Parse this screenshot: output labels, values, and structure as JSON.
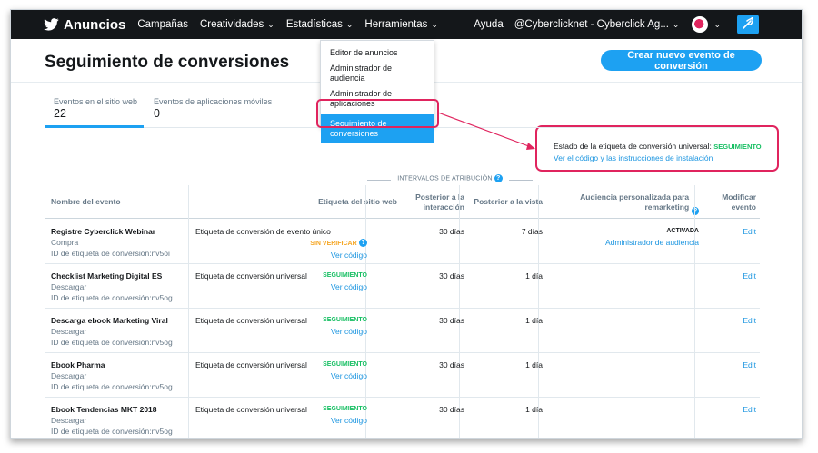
{
  "nav": {
    "brand": "Anuncios",
    "items": [
      "Campañas",
      "Creatividades",
      "Estadísticas",
      "Herramientas"
    ],
    "help": "Ayuda",
    "account": "@Cyberclicknet - Cyberclick Ag..."
  },
  "dropdown": {
    "items": [
      "Editor de anuncios",
      "Administrador de audiencia",
      "Administrador de aplicaciones",
      "Seguimiento de conversiones"
    ],
    "active_index": 3
  },
  "header": {
    "title": "Seguimiento de conversiones",
    "create_button": "Crear nuevo evento de conversión"
  },
  "tabs": [
    {
      "label": "Eventos en el sitio web",
      "count": "22"
    },
    {
      "label": "Eventos de aplicaciones móviles",
      "count": "0"
    }
  ],
  "callout": {
    "text": "Estado de la etiqueta de conversión universal:",
    "status": "SEGUIMIENTO",
    "link": "Ver el código y las instrucciones de instalación"
  },
  "table": {
    "group_header": "INTERVALOS DE ATRIBUCIÓN",
    "columns": {
      "name": "Nombre del evento",
      "tag": "Etiqueta del sitio web",
      "post_interaction": "Posterior a la interacción",
      "post_view": "Posterior a la vista",
      "audience": "Audiencia personalizada para remarketing",
      "modify": "Modificar evento"
    },
    "rows": [
      {
        "name": "Registre Cyberclick Webinar",
        "category": "Compra",
        "tag_id": "ID de etiqueta de conversión:nv5oi",
        "tag_type": "Etiqueta de conversión de evento único",
        "status": "SIN VERIFICAR",
        "view_code": "Ver código",
        "post_interaction": "30 días",
        "post_view": "7 días",
        "audience_status": "ACTIVADA",
        "audience_link": "Administrador de audiencia",
        "edit": "Edit"
      },
      {
        "name": "Checklist Marketing Digital ES",
        "category": "Descargar",
        "tag_id": "ID de etiqueta de conversión:nv5og",
        "tag_type": "Etiqueta de conversión universal",
        "status": "SEGUIMIENTO",
        "view_code": "Ver código",
        "post_interaction": "30 días",
        "post_view": "1 día",
        "audience_status": "",
        "audience_link": "",
        "edit": "Edit"
      },
      {
        "name": "Descarga ebook Marketing Viral",
        "category": "Descargar",
        "tag_id": "ID de etiqueta de conversión:nv5og",
        "tag_type": "Etiqueta de conversión universal",
        "status": "SEGUIMIENTO",
        "view_code": "Ver código",
        "post_interaction": "30 días",
        "post_view": "1 día",
        "audience_status": "",
        "audience_link": "",
        "edit": "Edit"
      },
      {
        "name": "Ebook Pharma",
        "category": "Descargar",
        "tag_id": "ID de etiqueta de conversión:nv5og",
        "tag_type": "Etiqueta de conversión universal",
        "status": "SEGUIMIENTO",
        "view_code": "Ver código",
        "post_interaction": "30 días",
        "post_view": "1 día",
        "audience_status": "",
        "audience_link": "",
        "edit": "Edit"
      },
      {
        "name": "Ebook Tendencias MKT 2018",
        "category": "Descargar",
        "tag_id": "ID de etiqueta de conversión:nv5og",
        "tag_type": "Etiqueta de conversión universal",
        "status": "SEGUIMIENTO",
        "view_code": "Ver código",
        "post_interaction": "30 días",
        "post_view": "1 día",
        "audience_status": "",
        "audience_link": "",
        "edit": "Edit"
      }
    ]
  },
  "colors": {
    "brand_blue": "#1da1f2",
    "nav_bg": "#14171a",
    "highlight_red": "#e0245e",
    "status_green": "#17bf63",
    "status_orange": "#f5a623"
  }
}
